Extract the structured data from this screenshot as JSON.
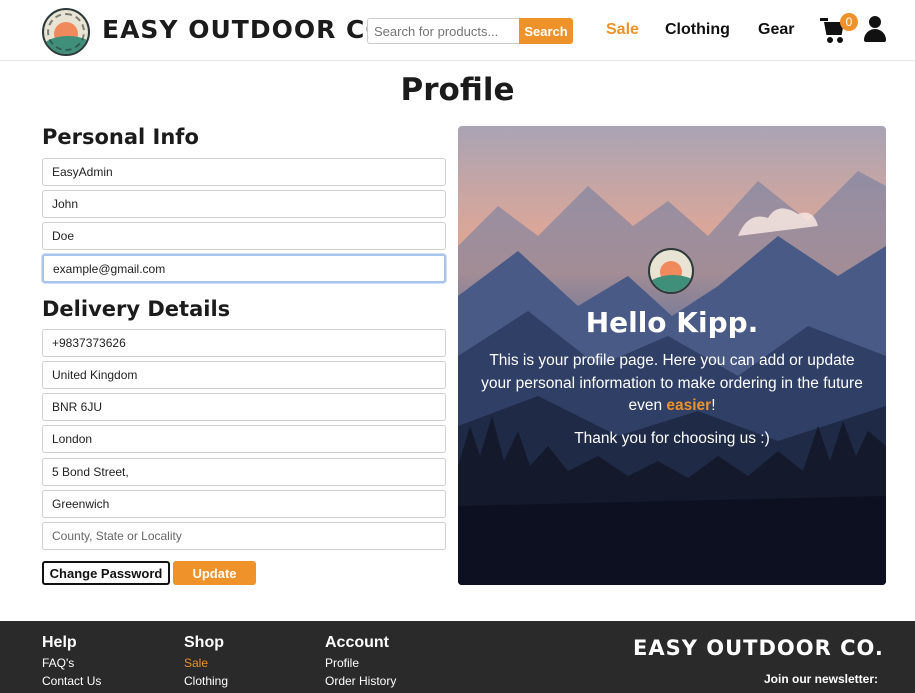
{
  "header": {
    "brand": "EASY OUTDOOR CO.",
    "search_placeholder": "Search for products...",
    "search_button": "Search",
    "nav": {
      "sale": "Sale",
      "clothing": "Clothing",
      "gear": "Gear"
    },
    "cart_count": "0"
  },
  "page_title": "Profile",
  "personal_info": {
    "title": "Personal Info",
    "username": "EasyAdmin",
    "first_name": "John",
    "last_name": "Doe",
    "email": "example@gmail.com"
  },
  "delivery": {
    "title": "Delivery Details",
    "phone": "+9837373626",
    "country": "United Kingdom",
    "postcode": "BNR 6JU",
    "town": "London",
    "street1": "5 Bond Street,",
    "street2": "Greenwich",
    "county_placeholder": "County, State or Locality"
  },
  "buttons": {
    "change_password": "Change Password",
    "update": "Update"
  },
  "hero": {
    "title": "Hello Kipp.",
    "text_before": "This is your profile page. Here you can add or update your personal information to make ordering in the future even ",
    "text_accent": "easier",
    "text_after": "!",
    "thanks": "Thank you for choosing us :)"
  },
  "footer": {
    "help": {
      "title": "Help",
      "faq": "FAQ's",
      "contact": "Contact Us"
    },
    "shop": {
      "title": "Shop",
      "sale": "Sale",
      "clothing": "Clothing"
    },
    "account": {
      "title": "Account",
      "profile": "Profile",
      "orders": "Order History"
    },
    "brand": "EASY OUTDOOR CO.",
    "newsletter": "Join our newsletter:"
  },
  "colors": {
    "accent": "#f0922a",
    "footer_bg": "#2a2a2a"
  }
}
